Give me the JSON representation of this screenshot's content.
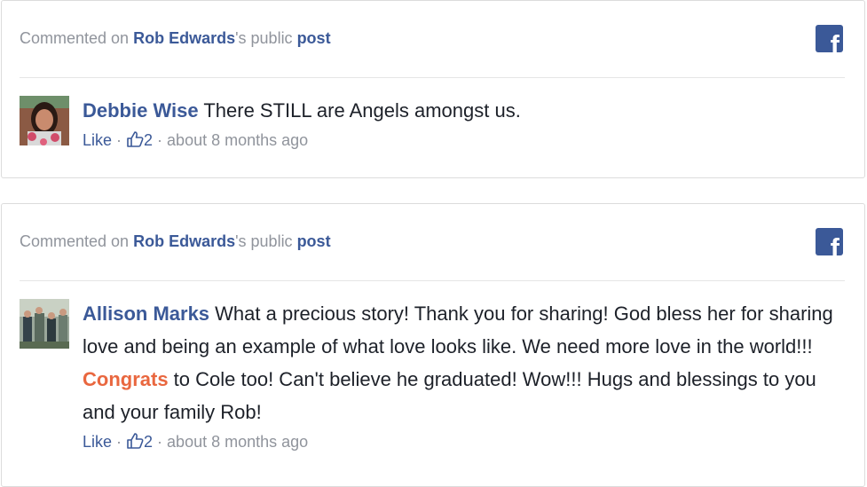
{
  "comments": [
    {
      "header": {
        "prefix": "Commented on ",
        "person": "Rob Edwards",
        "suffix": "'s public ",
        "link": "post"
      },
      "author": "Debbie Wise",
      "text": " There STILL are Angels amongst us.",
      "like_label": "Like",
      "sep1": " · ",
      "like_count": "2",
      "sep2": " · ",
      "time": "about 8 months ago"
    },
    {
      "header": {
        "prefix": "Commented on ",
        "person": "Rob Edwards",
        "suffix": "'s public ",
        "link": "post"
      },
      "author": "Allison Marks",
      "text_before": " What a precious story! Thank you for sharing! God bless her for sharing love and being an example of what love looks like. We need more love in the world!!! ",
      "highlight": "Congrats",
      "text_after": " to Cole too! Can't believe he graduated! Wow!!! Hugs and blessings to you and your family Rob!",
      "like_label": "Like",
      "sep1": " · ",
      "like_count": "2",
      "sep2": " · ",
      "time": "about 8 months ago"
    }
  ],
  "icons": {
    "network": "facebook-icon",
    "like": "thumbs-up-icon"
  },
  "colors": {
    "link": "#3b5998",
    "muted": "#90949c",
    "highlight": "#e9673f",
    "text": "#1d2129"
  },
  "fb_glyph": "f"
}
